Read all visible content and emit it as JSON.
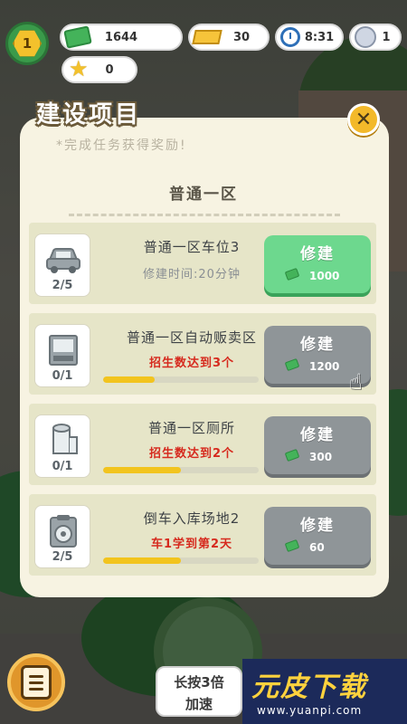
{
  "hud": {
    "level": "1",
    "cash": "1644",
    "gold": "30",
    "time": "8:31",
    "students": "1",
    "stars": "0"
  },
  "dialog": {
    "title": "建设项目",
    "subtitle": "*完成任务获得奖励!",
    "close_symbol": "✕",
    "section_title": "普通一区"
  },
  "rows": [
    {
      "name": "普通一区车位3",
      "count": "2/5",
      "info": "修建时间:20分钟",
      "info_type": "time",
      "button_label": "修建",
      "cost": "1000",
      "button_state": "active",
      "progress": null,
      "icon": "car-icon"
    },
    {
      "name": "普通一区自动贩卖区",
      "count": "0/1",
      "info": "招生数达到3个",
      "info_type": "requirement",
      "button_label": "修建",
      "cost": "1200",
      "button_state": "locked",
      "progress": 0.33,
      "icon": "vending-machine-icon"
    },
    {
      "name": "普通一区厕所",
      "count": "0/1",
      "info": "招生数达到2个",
      "info_type": "requirement",
      "button_label": "修建",
      "cost": "300",
      "button_state": "locked",
      "progress": 0.5,
      "icon": "toilet-paper-icon"
    },
    {
      "name": "倒车入库场地2",
      "count": "2/5",
      "info": "车1学到第2天",
      "info_type": "requirement",
      "button_label": "修建",
      "cost": "60",
      "button_state": "locked",
      "progress": 0.5,
      "icon": "clipboard-steering-icon"
    }
  ],
  "bottom": {
    "speed_line1": "长按3倍",
    "speed_line2": "加速"
  },
  "watermark": {
    "logo": "元皮下载",
    "url": "www.yuanpi.com"
  },
  "colors": {
    "dialog_bg": "#f7f3e2",
    "row_bg": "#e6e5c8",
    "active_button": "#6dd88e",
    "locked_button": "#8f9598",
    "progress_fill": "#f2c41e",
    "requirement_text": "#d62a1e"
  }
}
